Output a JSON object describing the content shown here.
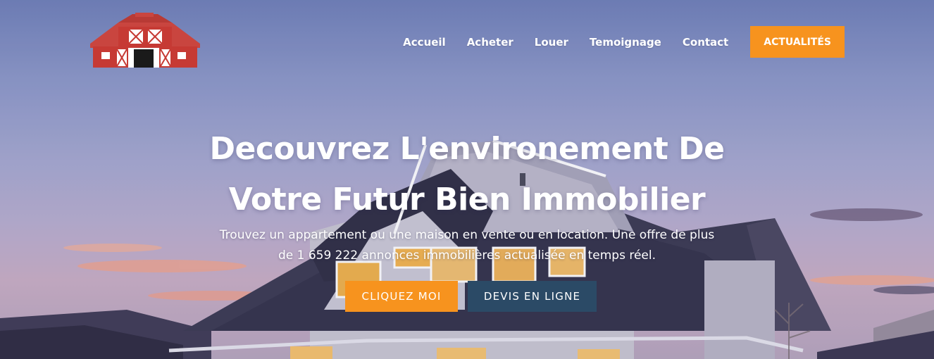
{
  "brand": {
    "logo_icon": "red-barn-logo",
    "accent": "#f7931e",
    "secondary": "#2b4a66"
  },
  "nav": {
    "items": [
      {
        "label": "Accueil"
      },
      {
        "label": "Acheter"
      },
      {
        "label": "Louer"
      },
      {
        "label": "Temoignage"
      },
      {
        "label": "Contact"
      }
    ],
    "cta_label": "ACTUALITÉS"
  },
  "hero": {
    "headline_line1": "Decouvrez L'environement De",
    "headline_line2": "Votre Futur Bien Immobilier",
    "subtitle_line1": "Trouvez un appartement ou une maison en vente ou en location. Une offre de plus",
    "subtitle_line2": "de 1 659 222 annonces immobilières actualisée en temps réel.",
    "primary_button": "CLIQUEZ MOI",
    "secondary_button": "DEVIS EN LIGNE"
  }
}
